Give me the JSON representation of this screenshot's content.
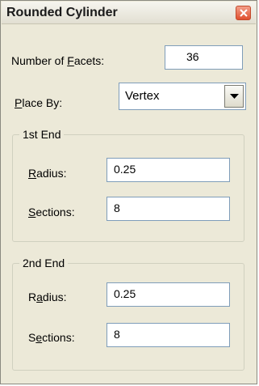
{
  "window": {
    "title": "Rounded Cylinder"
  },
  "facets": {
    "label_prefix": "Number of ",
    "label_accel": "F",
    "label_suffix": "acets:",
    "value": "36"
  },
  "place_by": {
    "label_accel": "P",
    "label_suffix": "lace By:",
    "selected": "Vertex"
  },
  "first_end": {
    "title": "1st End",
    "radius": {
      "label_accel": "R",
      "label_suffix": "adius:",
      "value": "0.25"
    },
    "sections": {
      "label_accel": "S",
      "label_suffix": "ections:",
      "value": "8"
    }
  },
  "second_end": {
    "title": "2nd End",
    "radius": {
      "label_prefix": "R",
      "label_accel": "a",
      "label_suffix": "dius:",
      "value": "0.25"
    },
    "sections": {
      "label_prefix": "S",
      "label_accel": "e",
      "label_suffix": "ctions:",
      "value": "8"
    }
  },
  "icons": {
    "close": "close-icon",
    "dropdown": "chevron-down-icon"
  },
  "colors": {
    "close_button": "#e0502e",
    "dialog_bg": "#ece9d8",
    "field_border": "#7f9db9"
  }
}
